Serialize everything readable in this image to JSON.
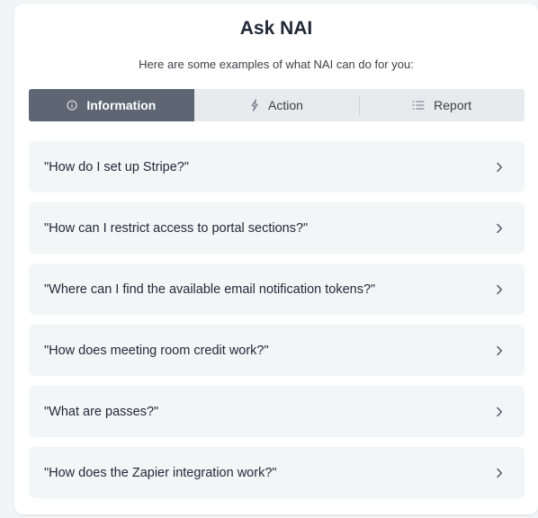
{
  "header": {
    "title": "Ask NAI",
    "subtitle": "Here are some examples of what NAI can do for you:"
  },
  "tabs": [
    {
      "label": "Information",
      "icon": "info-icon",
      "active": true
    },
    {
      "label": "Action",
      "icon": "lightning-icon",
      "active": false
    },
    {
      "label": "Report",
      "icon": "list-icon",
      "active": false
    }
  ],
  "questions": [
    {
      "label": "\"How do I set up Stripe?\""
    },
    {
      "label": "\"How can I restrict access to portal sections?\""
    },
    {
      "label": "\"Where can I find the available email notification tokens?\""
    },
    {
      "label": "\"How does meeting room credit work?\""
    },
    {
      "label": "\"What are passes?\""
    },
    {
      "label": "\"How does the Zapier integration work?\""
    }
  ],
  "colors": {
    "active_tab": "#5e6673",
    "tab_bar": "#e8eaee",
    "item_bg": "#f4f5f7"
  }
}
